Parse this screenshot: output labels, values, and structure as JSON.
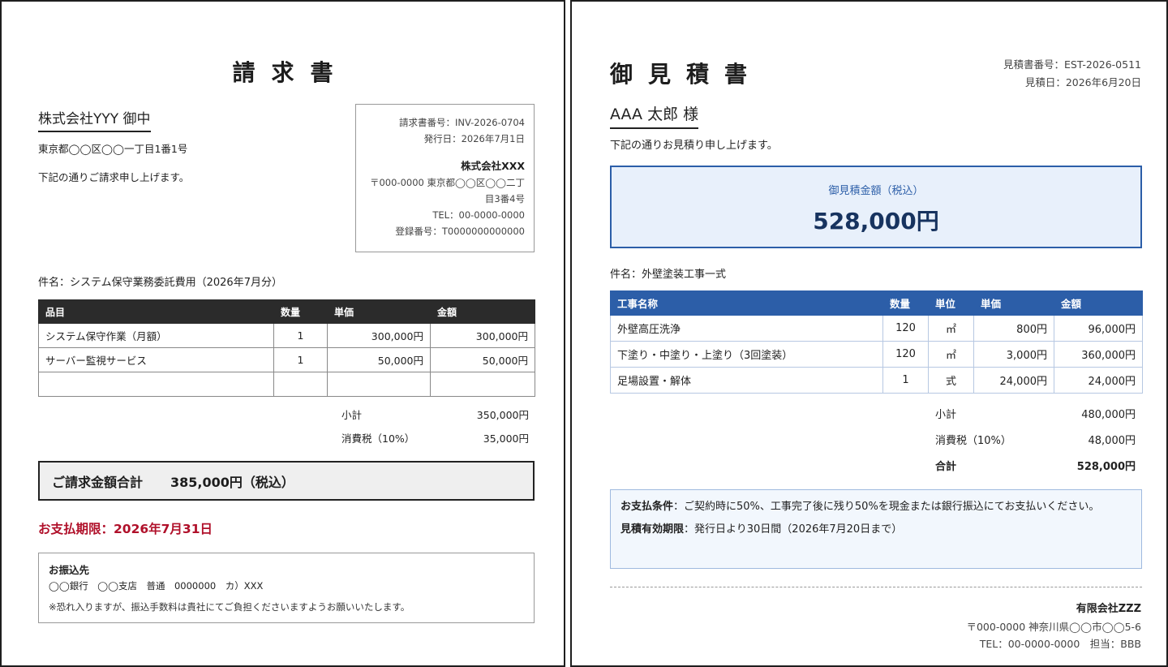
{
  "invoice": {
    "title": "請求書",
    "client_name": "株式会社YYY 御中",
    "client_address": "東京都◯◯区◯◯一丁目1番1号",
    "message": "下記の通りご請求申し上げます。",
    "issuer": {
      "invoice_number": "請求書番号：INV-2026-0704",
      "issue_date": "発行日：2026年7月1日",
      "company": "株式会社XXX",
      "address": "〒000-0000 東京都◯◯区◯◯二丁目3番4号",
      "tel": "TEL：00-0000-0000",
      "registration": "登録番号：T0000000000000"
    },
    "subject": "件名：システム保守業務委託費用（2026年7月分）",
    "table": {
      "headers": [
        "品目",
        "数量",
        "単価",
        "金額"
      ],
      "rows": [
        [
          "システム保守作業（月額）",
          "1",
          "300,000円",
          "300,000円"
        ],
        [
          "サーバー監視サービス",
          "1",
          "50,000円",
          "50,000円"
        ],
        [
          "",
          "",
          "",
          ""
        ]
      ]
    },
    "subtotal_label": "小計",
    "subtotal_value": "350,000円",
    "tax_label": "消費税（10%）",
    "tax_value": "35,000円",
    "total_label": "ご請求金額合計",
    "total_value": "385,000円（税込）",
    "deadline": "お支払期限：2026年7月31日",
    "bank": {
      "heading": "お振込先",
      "details": "◯◯銀行　◯◯支店　普通　0000000　カ）XXX",
      "note": "※恐れ入りますが、振込手数料は貴社にてご負担くださいますようお願いいたします。"
    }
  },
  "estimate": {
    "title": "御見積書",
    "estimate_number": "見積書番号：EST-2026-0511",
    "estimate_date": "見積日：2026年6月20日",
    "client_name": "AAA 太郎 様",
    "message": "下記の通りお見積り申し上げます。",
    "amount_label": "御見積金額（税込）",
    "amount_value": "528,000円",
    "subject": "件名：外壁塗装工事一式",
    "table": {
      "headers": [
        "工事名称",
        "数量",
        "単位",
        "単価",
        "金額"
      ],
      "rows": [
        [
          "外壁高圧洗浄",
          "120",
          "㎡",
          "800円",
          "96,000円"
        ],
        [
          "下塗り・中塗り・上塗り（3回塗装）",
          "120",
          "㎡",
          "3,000円",
          "360,000円"
        ],
        [
          "足場設置・解体",
          "1",
          "式",
          "24,000円",
          "24,000円"
        ]
      ]
    },
    "subtotal_label": "小計",
    "subtotal_value": "480,000円",
    "tax_label": "消費税（10%）",
    "tax_value": "48,000円",
    "total_label": "合計",
    "total_value": "528,000円",
    "payment_terms_label": "お支払条件",
    "payment_terms_text": "：ご契約時に50%、工事完了後に残り50%を現金または銀行振込にてお支払いください。",
    "validity_label": "見積有効期限",
    "validity_text": "：発行日より30日間（2026年7月20日まで）",
    "company": "有限会社ZZZ",
    "company_address": "〒000-0000 神奈川県◯◯市◯◯5-6",
    "company_contact": "TEL：00-0000-0000　担当：BBB"
  }
}
